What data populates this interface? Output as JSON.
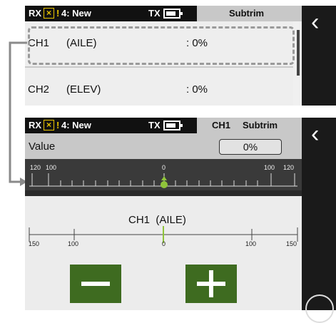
{
  "top": {
    "status": {
      "rx": "RX",
      "warn_icon": "×",
      "model": "4: New",
      "tx": "TX"
    },
    "title": "Subtrim",
    "rows": [
      {
        "channel": "CH1",
        "function": "(AILE)",
        "value": ": 0%"
      },
      {
        "channel": "CH2",
        "function": "(ELEV)",
        "value": ": 0%"
      }
    ]
  },
  "bottom": {
    "status": {
      "rx": "RX",
      "warn_icon": "×",
      "model": "4: New",
      "tx": "TX"
    },
    "channel": "CH1",
    "title": "Subtrim",
    "value_label": "Value",
    "value": "0%",
    "dark_scale": {
      "left": [
        "120",
        "100"
      ],
      "center": "0",
      "right": [
        "100",
        "120"
      ]
    },
    "channel_full": "CH1  (AILE)",
    "scale_labels": {
      "l150": "150",
      "l100": "100",
      "c0": "0",
      "r100": "100",
      "r150": "150"
    },
    "minus_label": "−",
    "plus_label": "+",
    "colors": {
      "button": "#3e6b20",
      "marker": "#8fc43a",
      "status_bg": "#111111",
      "title_bg": "#c8c8c8"
    }
  },
  "icons": {
    "back": "chevron-left-icon",
    "warning": "warning-box-icon",
    "battery": "battery-icon"
  }
}
